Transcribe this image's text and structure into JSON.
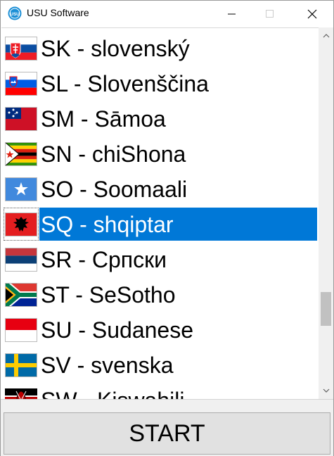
{
  "window": {
    "title": "USU Software",
    "app_icon_text": "USU"
  },
  "languages": [
    {
      "label": "SK - slovenský",
      "flag": "slovakia-flag-icon"
    },
    {
      "label": "SL - Slovenščina",
      "flag": "slovenia-flag-icon"
    },
    {
      "label": "SM - Sāmoa",
      "flag": "samoa-flag-icon"
    },
    {
      "label": "SN - chiShona",
      "flag": "zimbabwe-flag-icon"
    },
    {
      "label": "SO - Soomaali",
      "flag": "somalia-flag-icon"
    },
    {
      "label": "SQ - shqiptar",
      "flag": "albania-flag-icon",
      "selected": true
    },
    {
      "label": "SR - Српски",
      "flag": "serbia-flag-icon"
    },
    {
      "label": "ST - SeSotho",
      "flag": "south-africa-flag-icon"
    },
    {
      "label": "SU - Sudanese",
      "flag": "indonesia-flag-icon"
    },
    {
      "label": "SV - svenska",
      "flag": "sweden-flag-icon"
    },
    {
      "label": "SW - Kiswahili",
      "flag": "kenya-flag-icon"
    }
  ],
  "footer": {
    "start_label": "START"
  },
  "colors": {
    "selection": "#0078d7",
    "app_icon": "#1b8fd6"
  }
}
